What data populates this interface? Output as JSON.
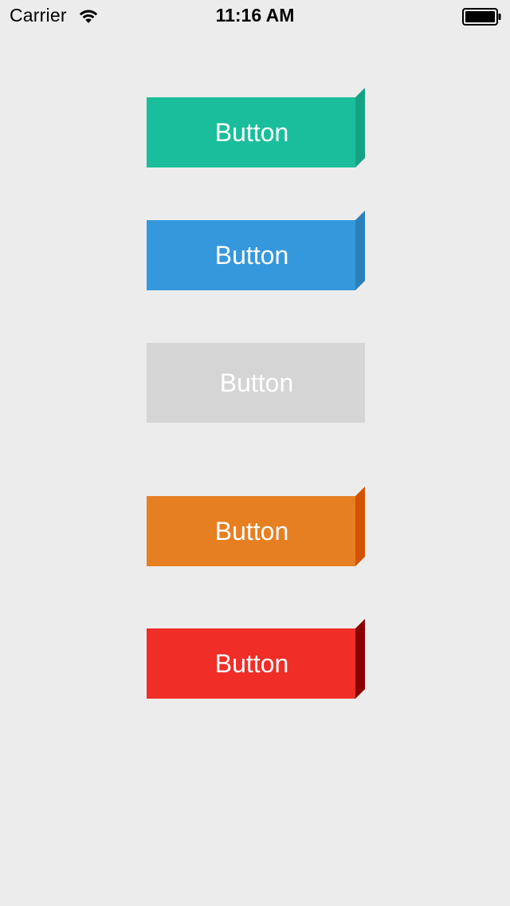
{
  "status_bar": {
    "carrier": "Carrier",
    "time": "11:16 AM",
    "wifi_icon": "wifi-icon",
    "battery_icon": "battery-icon"
  },
  "buttons": [
    {
      "label": "Button",
      "face_color": "#1bbe9c",
      "side_color": "#15a283",
      "state": "enabled"
    },
    {
      "label": "Button",
      "face_color": "#3598dc",
      "side_color": "#2c80b9",
      "state": "enabled"
    },
    {
      "label": "Button",
      "face_color": "#d5d5d5",
      "text_color": "#ffffff",
      "state": "disabled"
    },
    {
      "label": "Button",
      "face_color": "#e67f22",
      "side_color": "#d35400",
      "state": "enabled"
    },
    {
      "label": "Button",
      "face_color": "#f02d27",
      "side_color": "#8b0000",
      "state": "enabled"
    }
  ],
  "colors": {
    "background": "#ececec"
  }
}
